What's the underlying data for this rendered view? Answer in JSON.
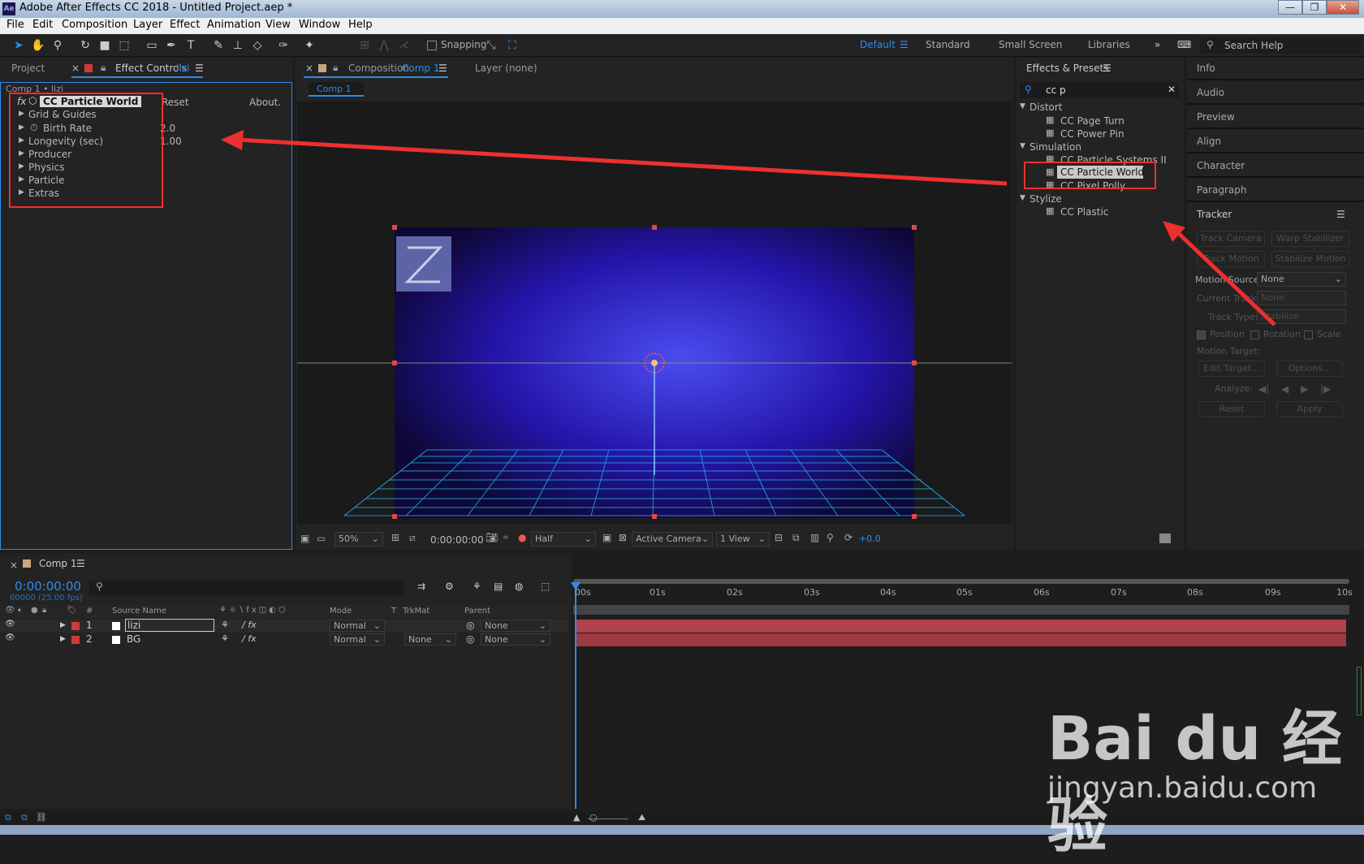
{
  "app": {
    "title": "Adobe After Effects CC 2018 - Untitled Project.aep *",
    "icon_label": "Ae",
    "win_min": "—",
    "win_max": "❐",
    "win_close": "✕"
  },
  "menu": [
    "File",
    "Edit",
    "Composition",
    "Layer",
    "Effect",
    "Animation",
    "View",
    "Window",
    "Help"
  ],
  "toolbar": {
    "snapping": "Snapping",
    "workspaces": [
      "Default",
      "Standard",
      "Small Screen",
      "Libraries"
    ],
    "search_help": "Search Help"
  },
  "effect_controls": {
    "project_tab": "Project",
    "tab_label": "Effect Controls",
    "layer_name": "lizi",
    "breadcrumb": "Comp 1 • lizi",
    "effect_name": "CC Particle World",
    "reset": "Reset",
    "about": "About.",
    "props": [
      "Grid & Guides",
      "Birth Rate",
      "Longevity (sec)",
      "Producer",
      "Physics",
      "Particle",
      "Extras"
    ],
    "birth_rate_value": "2.0",
    "longevity_value": "1.00"
  },
  "composition": {
    "tab_label": "Composition",
    "comp_name": "Comp 1",
    "layer_tab": "Layer (none)",
    "sub_tab": "Comp 1",
    "zoom": "50%",
    "timecode": "0:00:00:00",
    "resolution": "Half",
    "camera": "Active Camera",
    "views": "1 View",
    "exposure": "+0.0"
  },
  "effects_presets": {
    "title": "Effects & Presets",
    "search": "cc p",
    "groups": [
      {
        "name": "Distort",
        "items": [
          "CC Page Turn",
          "CC Power Pin"
        ]
      },
      {
        "name": "Simulation",
        "items": [
          "CC Particle Systems II",
          "CC Particle World",
          "CC Pixel Polly"
        ]
      },
      {
        "name": "Stylize",
        "items": [
          "CC Plastic"
        ]
      }
    ]
  },
  "right_panels": [
    "Info",
    "Audio",
    "Preview",
    "Align",
    "Character",
    "Paragraph"
  ],
  "tracker": {
    "title": "Tracker",
    "track_camera": "Track Camera",
    "warp_stabilizer": "Warp Stabilizer",
    "track_motion": "Track Motion",
    "stabilize_motion": "Stabilize Motion",
    "motion_source_label": "Motion Source:",
    "motion_source_value": "None",
    "current_track_label": "Current Track:",
    "current_track_value": "None",
    "track_type_label": "Track Type:",
    "track_type_value": "Stabilize",
    "position": "Position",
    "rotation": "Rotation",
    "scale": "Scale",
    "motion_target": "Motion Target:",
    "edit_target": "Edit Target...",
    "options": "Options...",
    "analyze": "Analyze:",
    "reset": "Reset",
    "apply": "Apply"
  },
  "timeline": {
    "tab": "Comp 1",
    "timecode": "0:00:00:00",
    "fps": "00000 (25.00 fps)",
    "columns": {
      "num": "#",
      "source": "Source Name",
      "mode": "Mode",
      "t": "T",
      "trkmat": "TrkMat",
      "parent": "Parent"
    },
    "ruler": [
      "00s",
      "01s",
      "02s",
      "03s",
      "04s",
      "05s",
      "06s",
      "07s",
      "08s",
      "09s",
      "10s"
    ],
    "layers": [
      {
        "num": "1",
        "name": "lizi",
        "mode": "Normal",
        "trkmat": "",
        "parent": "None"
      },
      {
        "num": "2",
        "name": "BG",
        "mode": "Normal",
        "trkmat": "None",
        "parent": "None"
      }
    ]
  },
  "watermark": {
    "brand": "Bai du 经验",
    "url": "jingyan.baidu.com"
  },
  "colors": {
    "accent": "#2d8ceb",
    "annotation": "#ee2f2f",
    "layer_bar": "#b1414a",
    "panel": "#232323"
  }
}
